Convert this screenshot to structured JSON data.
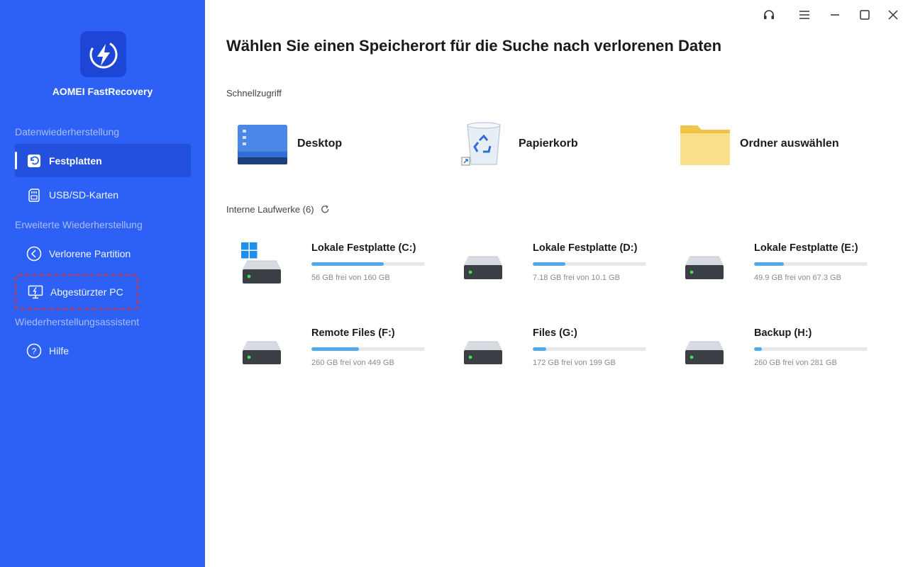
{
  "app": {
    "name": "AOMEI FastRecovery"
  },
  "sidebar": {
    "sections": [
      {
        "label": "Datenwiederherstellung"
      },
      {
        "label": "Erweiterte Wiederherstellung"
      },
      {
        "label": "Wiederherstellungsassistent"
      }
    ],
    "items": [
      {
        "label": "Festplatten",
        "icon": "restore-icon",
        "active": true
      },
      {
        "label": "USB/SD-Karten",
        "icon": "sd-card-icon"
      },
      {
        "label": "Verlorene Partition",
        "icon": "partition-icon"
      },
      {
        "label": "Abgestürzter PC",
        "icon": "crashed-pc-icon"
      },
      {
        "label": "Hilfe",
        "icon": "help-icon"
      }
    ]
  },
  "window_controls": [
    "support-icon",
    "menu-icon",
    "minimize-icon",
    "maximize-icon",
    "close-icon"
  ],
  "main": {
    "title": "Wählen Sie einen Speicherort für die Suche nach verlorenen Daten",
    "quick_access": {
      "label": "Schnellzugriff",
      "items": [
        {
          "label": "Desktop",
          "icon": "desktop-icon"
        },
        {
          "label": "Papierkorb",
          "icon": "recycle-bin-icon"
        },
        {
          "label": "Ordner auswählen",
          "icon": "folder-icon"
        }
      ]
    },
    "drives": {
      "label": "Interne Laufwerke (6)",
      "items": [
        {
          "name": "Lokale Festplatte (C:)",
          "info": "56 GB frei von 160 GB",
          "used_fraction": 0.64,
          "system": true
        },
        {
          "name": "Lokale Festplatte (D:)",
          "info": "7.18 GB frei von 10.1 GB",
          "used_fraction": 0.29
        },
        {
          "name": "Lokale Festplatte (E:)",
          "info": "49.9 GB frei von 67.3 GB",
          "used_fraction": 0.26
        },
        {
          "name": "Remote Files (F:)",
          "info": "260 GB frei von 449 GB",
          "used_fraction": 0.42
        },
        {
          "name": "Files (G:)",
          "info": "172 GB frei von 199 GB",
          "used_fraction": 0.12
        },
        {
          "name": "Backup (H:)",
          "info": "260 GB frei von 281 GB",
          "used_fraction": 0.07
        }
      ]
    }
  },
  "colors": {
    "sidebar": "#2d61f5",
    "accent_bar": "#52a9ea",
    "highlight": "#e8312e"
  }
}
